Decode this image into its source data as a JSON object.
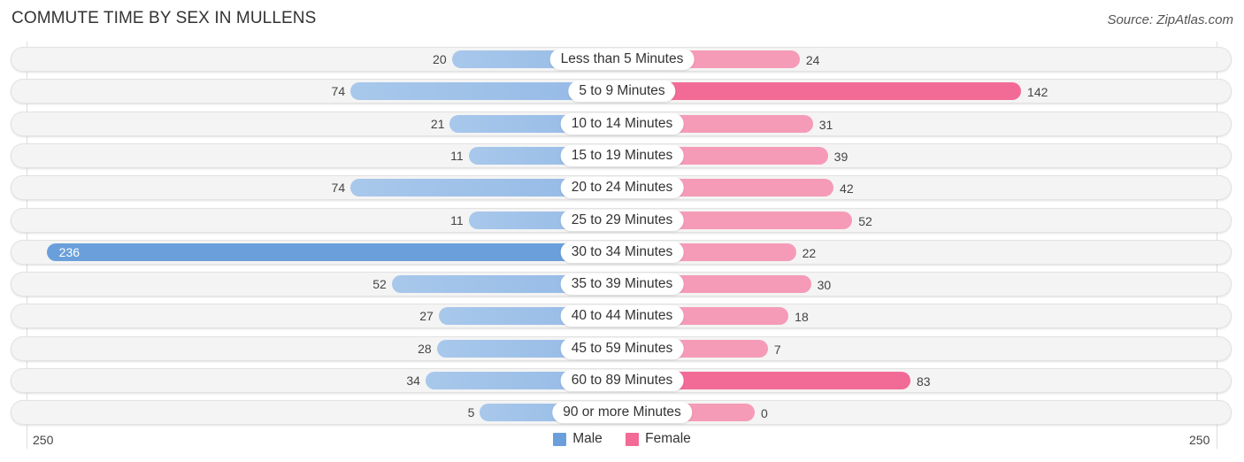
{
  "header": {
    "title": "COMMUTE TIME BY SEX IN MULLENS",
    "source": "Source: ZipAtlas.com"
  },
  "colors": {
    "male": "#6a9fdb",
    "female": "#f26b96"
  },
  "chart_data": {
    "type": "bar",
    "orientation": "horizontal-diverging",
    "title": "COMMUTE TIME BY SEX IN MULLENS",
    "categories": [
      "Less than 5 Minutes",
      "5 to 9 Minutes",
      "10 to 14 Minutes",
      "15 to 19 Minutes",
      "20 to 24 Minutes",
      "25 to 29 Minutes",
      "30 to 34 Minutes",
      "35 to 39 Minutes",
      "40 to 44 Minutes",
      "45 to 59 Minutes",
      "60 to 89 Minutes",
      "90 or more Minutes"
    ],
    "series": [
      {
        "name": "Male",
        "side": "left",
        "values": [
          20,
          74,
          21,
          11,
          74,
          11,
          236,
          52,
          27,
          28,
          34,
          5
        ]
      },
      {
        "name": "Female",
        "side": "right",
        "values": [
          24,
          142,
          31,
          39,
          42,
          52,
          22,
          30,
          18,
          7,
          83,
          0
        ]
      }
    ],
    "axis": {
      "left_tick": "250",
      "right_tick": "250",
      "max": 250
    },
    "legend": {
      "position": "bottom-center",
      "entries": [
        "Male",
        "Female"
      ]
    },
    "grid": false
  }
}
